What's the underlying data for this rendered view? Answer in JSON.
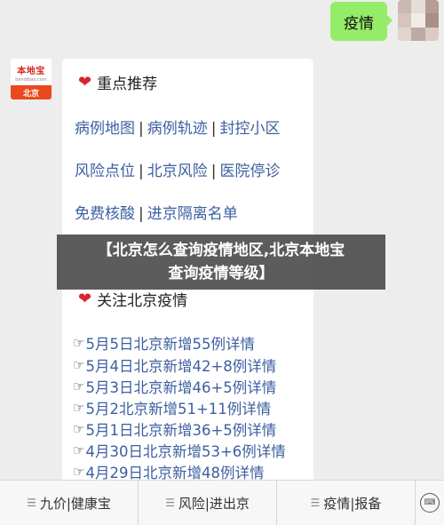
{
  "chat": {
    "sent_message": "疫情"
  },
  "bot": {
    "avatar": {
      "brand": "本地宝",
      "domain": "bendibao.com",
      "city": "北京"
    }
  },
  "card": {
    "section1_title": "重点推荐",
    "links_row1": [
      "病例地图",
      "病例轨迹",
      "封控小区"
    ],
    "links_row2": [
      "风险点位",
      "北京风险",
      "医院停诊"
    ],
    "links_row3": [
      "免费核酸",
      "进京隔离名单"
    ],
    "section2_title": "关注北京疫情",
    "news": [
      "5月5日北京新增55例详情",
      "5月4日北京新增42+8例详情",
      "5月3日北京新增46+5例详情",
      "5月2北京新增51+11例详情",
      "5月1日北京新增36+5例详情",
      "4月30日北京新增53+6例详情",
      "4月29日北京新增48例详情"
    ]
  },
  "overlay": {
    "line1": "【北京怎么查询疫情地区,北京本地宝",
    "line2": "查询疫情等级】"
  },
  "menu": {
    "items": [
      "九价|健康宝",
      "风险|进出京",
      "疫情|报备"
    ]
  },
  "icons": {
    "heart": "❤",
    "hand": "☞",
    "menu": "☰",
    "keyboard": "⌨"
  }
}
